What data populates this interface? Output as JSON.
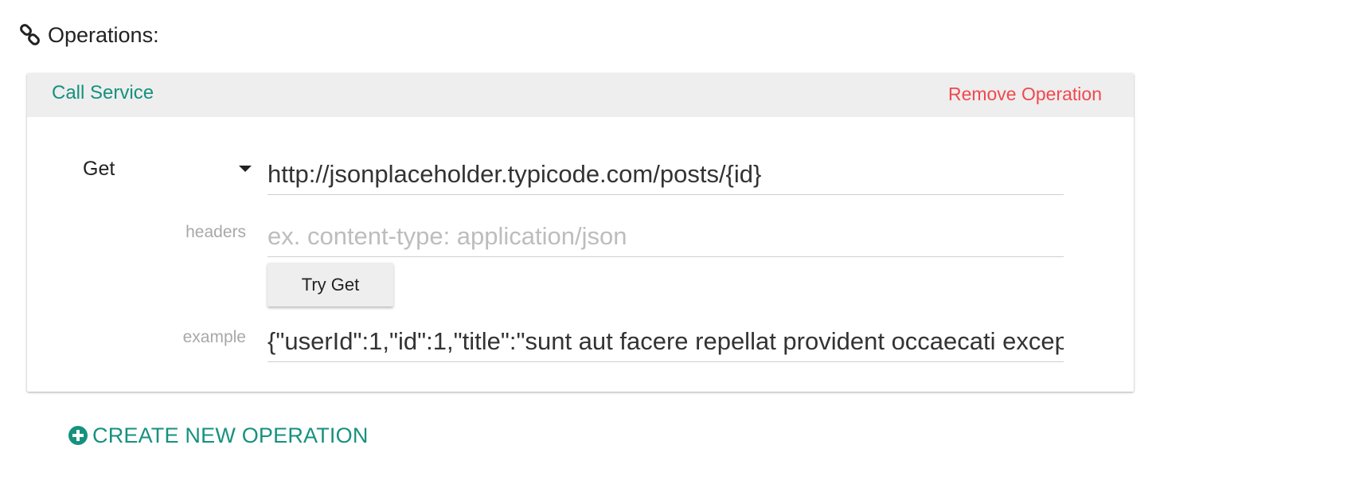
{
  "section": {
    "icon": "link-icon",
    "title": "Operations:"
  },
  "operation": {
    "type_label": "Call Service",
    "remove_label": "Remove Operation",
    "method": {
      "selected": "Get",
      "icon": "caret-down-icon"
    },
    "url": {
      "value": "http://jsonplaceholder.typicode.com/posts/{id}"
    },
    "headers": {
      "label": "headers",
      "value": "",
      "placeholder": "ex. content-type: application/json"
    },
    "try_button_label": "Try Get",
    "example": {
      "label": "example",
      "value": "{\"userId\":1,\"id\":1,\"title\":\"sunt aut facere repellat provident occaecati excep"
    }
  },
  "create_operation": {
    "icon": "plus-circle-icon",
    "label": "CREATE NEW OPERATION"
  },
  "colors": {
    "accent": "#16917f",
    "danger": "#f1484e",
    "header_bg": "#eeeeee",
    "muted_text": "#a8a8a8"
  }
}
